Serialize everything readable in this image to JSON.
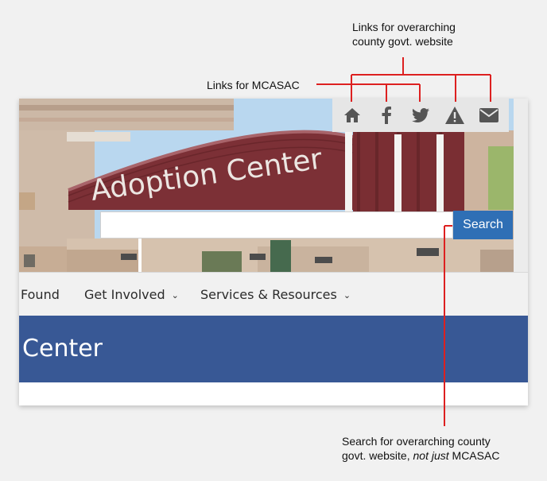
{
  "annotations": {
    "overarching_links": [
      "Links for overarching",
      "county govt. website"
    ],
    "mcasac_links": "Links for MCASAC",
    "search_note": {
      "line1": "Search for overarching county",
      "line2_before": "govt. website, ",
      "line2_emphasis": "not just",
      "line2_after": " MCASAC"
    },
    "line_color": "#dd2020"
  },
  "hero": {
    "building_sign": "Adoption Center"
  },
  "utility_bar": {
    "icons": [
      "home-icon",
      "facebook-icon",
      "twitter-icon",
      "alert-icon",
      "email-icon"
    ]
  },
  "search": {
    "input_value": "",
    "button_label": "Search"
  },
  "nav": {
    "items": [
      {
        "label": "Found",
        "has_dropdown": false
      },
      {
        "label": "Get Involved",
        "has_dropdown": true
      },
      {
        "label": "Services & Resources",
        "has_dropdown": true
      }
    ],
    "chevron": "⌄"
  },
  "page": {
    "title": "ption Center"
  },
  "colors": {
    "title_band": "#385895",
    "search_button": "#2f6fb5",
    "building_maroon": "#7c3036"
  }
}
